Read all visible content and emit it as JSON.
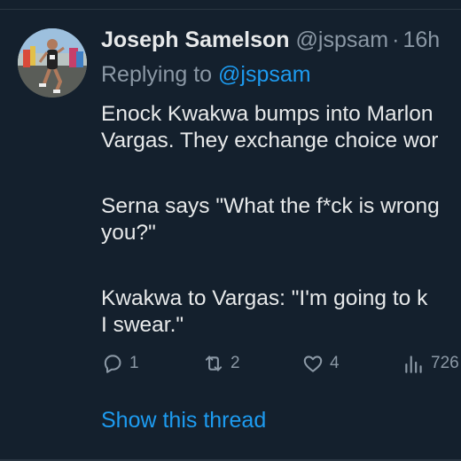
{
  "tweet": {
    "author_name": "Joseph Samelson",
    "author_handle": "@jspsam",
    "separator": "·",
    "time": "16h",
    "reply_prefix": "Replying to ",
    "reply_handle": "@jspsam",
    "body_lines": [
      "Enock Kwakwa bumps into Marlon",
      "Vargas. They exchange choice wor",
      "Serna says \"What the f*ck is wrong",
      "you?\"",
      "Kwakwa to Vargas:  \"I'm going to k",
      "I swear.\""
    ]
  },
  "actions": {
    "reply_count": "1",
    "retweet_count": "2",
    "like_count": "4",
    "view_count": "726"
  },
  "show_thread_label": "Show this thread",
  "colors": {
    "background": "#14202d",
    "text": "#e7e9ea",
    "muted": "#8b98a5",
    "link": "#1d9bf0"
  }
}
